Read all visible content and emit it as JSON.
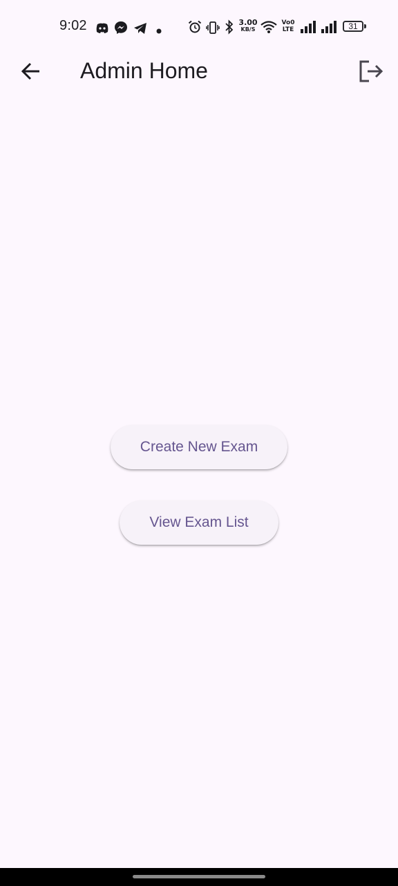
{
  "status_bar": {
    "time": "9:02",
    "net_speed_value": "3.00",
    "net_speed_unit": "KB/S",
    "volte_top": "Vo0",
    "volte_bottom": "LTE",
    "battery": "31",
    "icons": [
      "discord-icon",
      "messenger-icon",
      "telegram-icon",
      "dot-icon",
      "alarm-icon",
      "vibrate-icon",
      "bluetooth-icon",
      "wifi-icon",
      "signal-icon",
      "signal-icon",
      "battery-icon"
    ]
  },
  "app_bar": {
    "title": "Admin Home",
    "back_icon": "arrow-back-icon",
    "logout_icon": "logout-icon"
  },
  "main": {
    "create_button_label": "Create New Exam",
    "view_button_label": "View Exam List"
  },
  "colors": {
    "background": "#fdf7fe",
    "button_background": "#f7f2f9",
    "button_text": "#65558f",
    "title_text": "#1d1b20"
  }
}
